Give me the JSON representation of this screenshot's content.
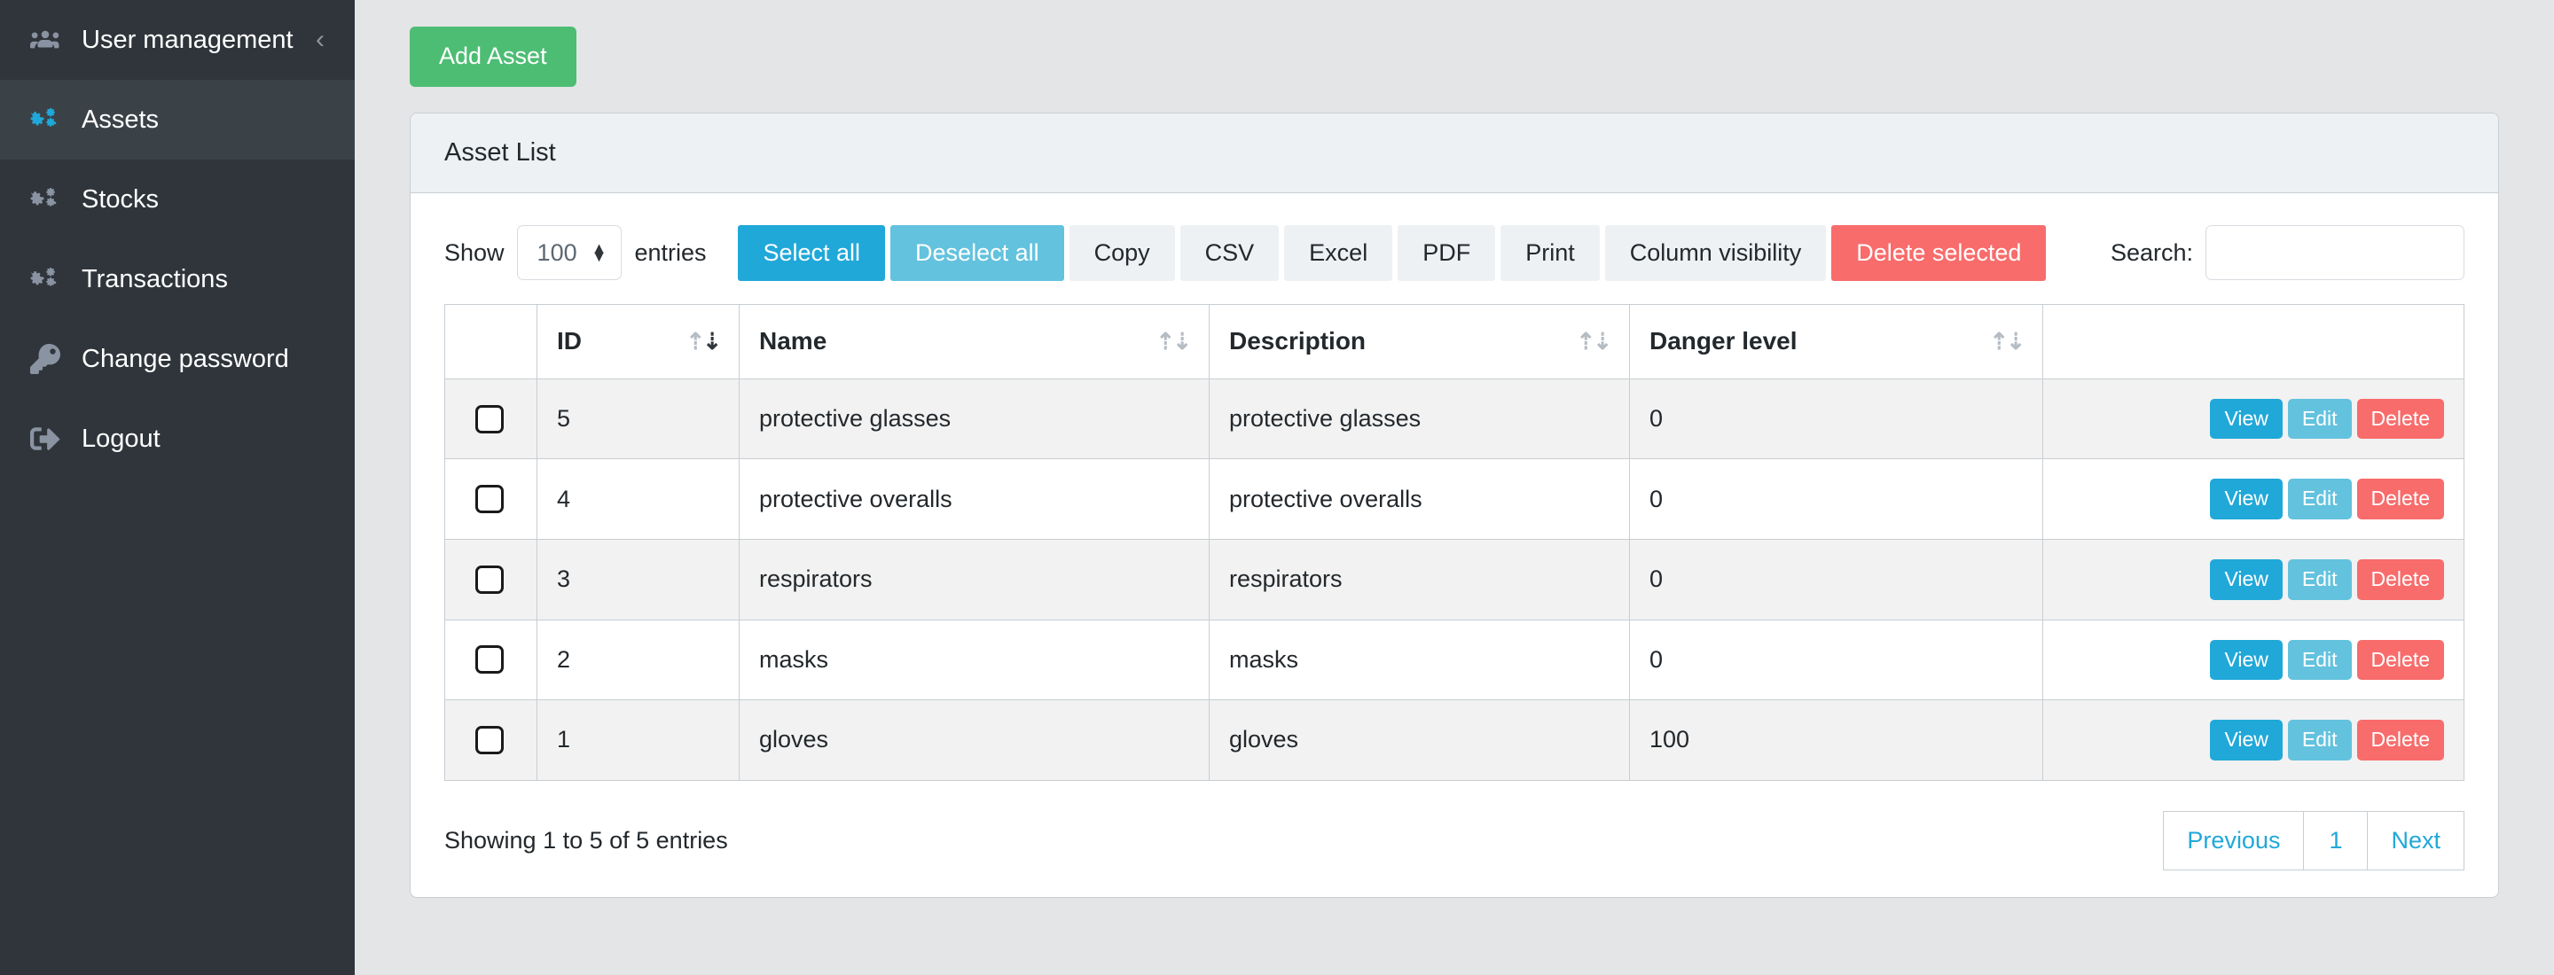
{
  "sidebar": {
    "items": [
      {
        "label": "User management",
        "icon": "users-icon",
        "active": false,
        "collapse": "‹"
      },
      {
        "label": "Assets",
        "icon": "cogs-icon",
        "active": true
      },
      {
        "label": "Stocks",
        "icon": "cogs-icon",
        "active": false
      },
      {
        "label": "Transactions",
        "icon": "cogs-icon",
        "active": false
      },
      {
        "label": "Change password",
        "icon": "key-icon",
        "active": false
      },
      {
        "label": "Logout",
        "icon": "sign-out-icon",
        "active": false
      }
    ]
  },
  "main": {
    "add_button_label": "Add Asset",
    "card_title": "Asset List"
  },
  "toolbar": {
    "show_label": "Show",
    "entries_label": "entries",
    "page_length_value": "100",
    "buttons": [
      {
        "label": "Select all",
        "style": "primary"
      },
      {
        "label": "Deselect all",
        "style": "info"
      },
      {
        "label": "Copy",
        "style": "default"
      },
      {
        "label": "CSV",
        "style": "default"
      },
      {
        "label": "Excel",
        "style": "default"
      },
      {
        "label": "PDF",
        "style": "default"
      },
      {
        "label": "Print",
        "style": "default"
      },
      {
        "label": "Column visibility",
        "style": "default"
      },
      {
        "label": "Delete selected",
        "style": "danger"
      }
    ],
    "search_label": "Search:",
    "search_value": "",
    "search_placeholder": ""
  },
  "table": {
    "columns": [
      {
        "label": "",
        "sortable": false,
        "sort": "none"
      },
      {
        "label": "ID",
        "sortable": true,
        "sort": "desc"
      },
      {
        "label": "Name",
        "sortable": true,
        "sort": "none"
      },
      {
        "label": "Description",
        "sortable": true,
        "sort": "none"
      },
      {
        "label": "Danger level",
        "sortable": true,
        "sort": "none"
      },
      {
        "label": "",
        "sortable": false,
        "sort": "none"
      }
    ],
    "rows": [
      {
        "id": "5",
        "name": "protective glasses",
        "description": "protective glasses",
        "danger_level": "0",
        "checked": false
      },
      {
        "id": "4",
        "name": "protective overalls",
        "description": "protective overalls",
        "danger_level": "0",
        "checked": false
      },
      {
        "id": "3",
        "name": "respirators",
        "description": "respirators",
        "danger_level": "0",
        "checked": false
      },
      {
        "id": "2",
        "name": "masks",
        "description": "masks",
        "danger_level": "0",
        "checked": false
      },
      {
        "id": "1",
        "name": "gloves",
        "description": "gloves",
        "danger_level": "100",
        "checked": false
      }
    ],
    "row_actions": [
      {
        "label": "View",
        "style": "act-view"
      },
      {
        "label": "Edit",
        "style": "act-edit"
      },
      {
        "label": "Delete",
        "style": "act-delete"
      }
    ]
  },
  "footer": {
    "info": "Showing 1 to 5 of 5 entries",
    "pagination": [
      {
        "label": "Previous",
        "type": "prev"
      },
      {
        "label": "1",
        "type": "num"
      },
      {
        "label": "Next",
        "type": "next"
      }
    ]
  },
  "colors": {
    "sidebar_bg": "#2f353a",
    "sidebar_active_bg": "#3a4248",
    "accent_blue": "#20a8d8",
    "accent_light_blue": "#63c2de",
    "accent_green": "#4dbd74",
    "accent_red": "#f86c6b",
    "page_bg": "#e4e5e6",
    "card_header_bg": "#eef1f3",
    "stripe_bg": "#f2f2f2"
  }
}
